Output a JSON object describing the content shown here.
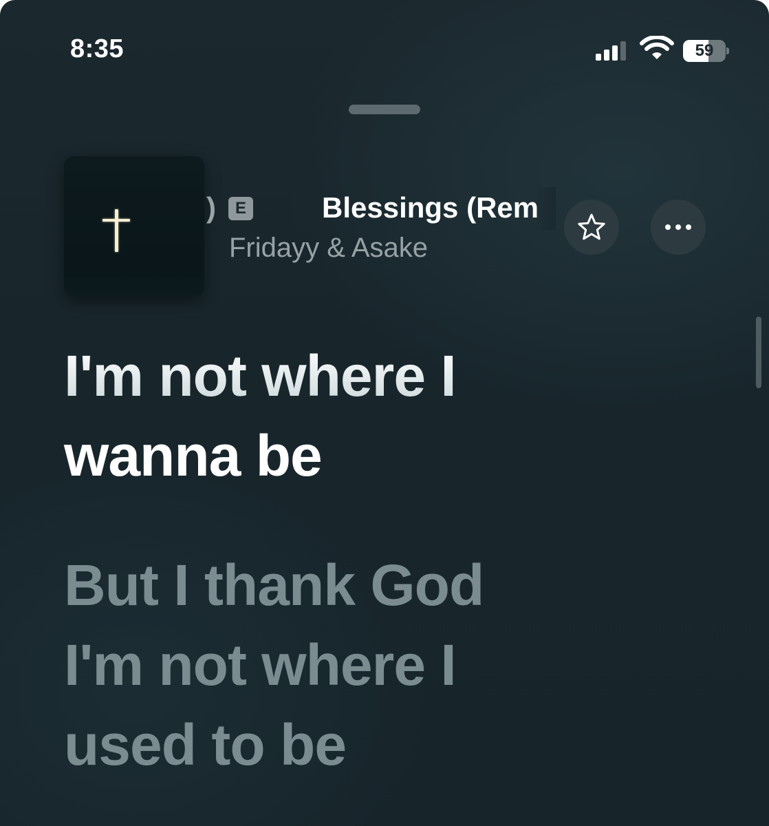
{
  "status_bar": {
    "time": "8:35",
    "battery_level": "59",
    "battery_fraction": 0.59,
    "signal_bars": 3,
    "icons": [
      "cellular-signal-icon",
      "wifi-icon",
      "battery-icon"
    ]
  },
  "now_playing": {
    "title_tail": ")",
    "explicit_badge": "E",
    "title": "Blessings (Rem",
    "artist": "Fridayy & Asake",
    "artwork_icon": "cross-icon"
  },
  "actions": {
    "favorite_icon": "star-icon",
    "more_icon": "ellipsis-icon"
  },
  "lyrics": {
    "active_lines": [
      "I'm not where I",
      "wanna be"
    ],
    "upcoming_lines": [
      "But I thank God",
      "I'm not where I",
      "used to be"
    ]
  },
  "colors": {
    "background": "#18262c",
    "button_bg": "#2d3b41",
    "dim_lyric": "#7b8c91",
    "active_lyric": "#ffffff"
  }
}
